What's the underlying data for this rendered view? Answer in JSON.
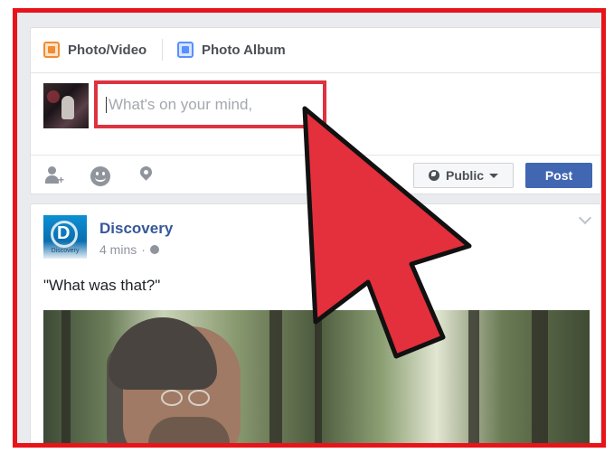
{
  "composer": {
    "tabs": [
      {
        "label": "Photo/Video",
        "icon": "photo-video-icon"
      },
      {
        "label": "Photo Album",
        "icon": "photo-album-icon"
      }
    ],
    "status_placeholder": "What's on your mind,",
    "privacy_label": "Public",
    "post_label": "Post",
    "action_icons": [
      "tag-friends-icon",
      "feeling-icon",
      "location-icon"
    ]
  },
  "post": {
    "page_name": "Discovery",
    "avatar_text": "Discovery",
    "time": "4 mins",
    "separator": "·",
    "text": "\"What was that?\""
  },
  "colors": {
    "frame_border": "#e8141a",
    "highlight_box": "#dd3340",
    "arrow_fill": "#e3303c",
    "post_button": "#4267b2",
    "link_blue": "#365899"
  }
}
